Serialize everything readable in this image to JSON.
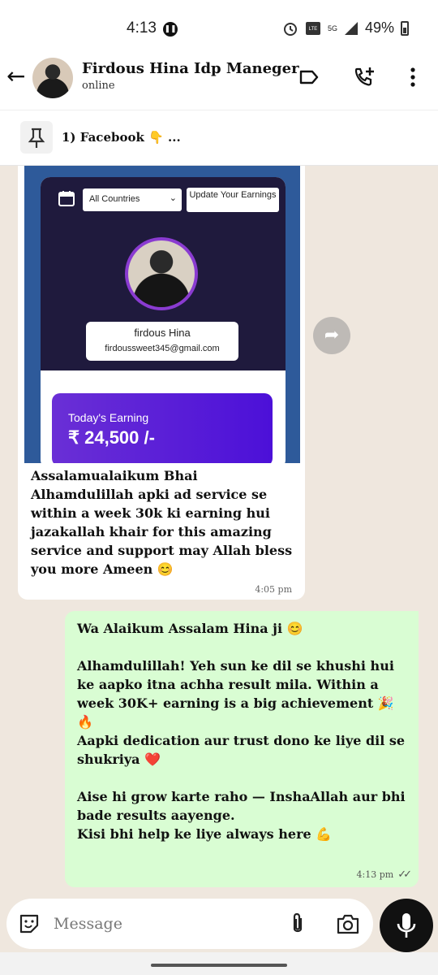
{
  "status_bar": {
    "time": "4:13",
    "battery": "49%",
    "network": "5G"
  },
  "header": {
    "contact_name": "Firdous Hina Idp Maneger",
    "contact_status": "online"
  },
  "pinned": {
    "text": "1) Facebook 👇 ..."
  },
  "incoming": {
    "image": {
      "country_select": "All Countries",
      "update_button": "Update Your Earnings",
      "profile_name": "firdous Hina",
      "profile_email": "firdoussweet345@gmail.com",
      "earning_label": "Today's Earning",
      "earning_value": "₹ 24,500 /-"
    },
    "text": "Assalamualaikum Bhai Alhamdulillah apki ad service se within a week 30k ki earning hui jazakallah khair for this amazing service and support may Allah bless you more Ameen 😊",
    "time": "4:05 pm"
  },
  "outgoing": {
    "text": "Wa Alaikum Assalam Hina ji 😊\n\nAlhamdulillah! Yeh sun ke dil se khushi hui ke aapko itna achha result mila. Within a week 30K+ earning is a big achievement 🎉 🔥\nAapki dedication aur trust dono ke liye dil se shukriya ❤️\n\nAise hi grow karte raho — InshaAllah aur bhi bade results aayenge.\nKisi bhi help ke liye always here 💪",
    "time": "4:13 pm"
  },
  "composer": {
    "placeholder": "Message"
  },
  "colors": {
    "chat_bg": "#efe7de",
    "outgoing_bubble": "#d9fdd3",
    "incoming_bubble": "#ffffff",
    "earning_card": "#5b1fd8"
  }
}
